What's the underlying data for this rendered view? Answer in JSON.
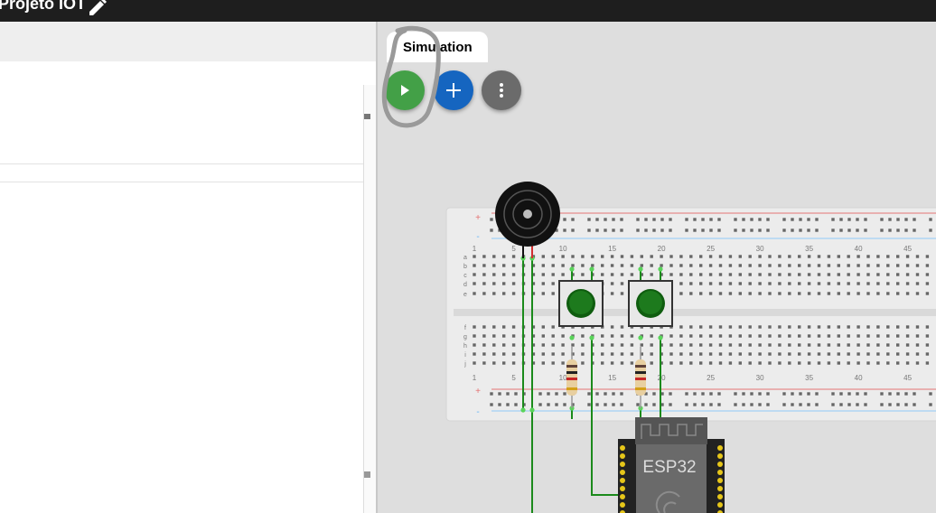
{
  "app": {
    "project_title": "Projeto IOT",
    "icons": {
      "edit": "pencil-icon"
    }
  },
  "simulation": {
    "tab_label": "Simulation",
    "controls": [
      {
        "name": "start-simulation-button",
        "icon": "play-icon",
        "color": "#43a047"
      },
      {
        "name": "add-part-button",
        "icon": "plus-icon",
        "color": "#1565c0"
      },
      {
        "name": "more-options-button",
        "icon": "more-vertical-icon",
        "color": "#6b6b6b"
      }
    ]
  },
  "diagram": {
    "microcontroller_label": "ESP32",
    "breadboard_column_numbers": [
      "1",
      "5",
      "10",
      "15",
      "20",
      "25",
      "30",
      "35",
      "40",
      "45"
    ],
    "breadboard_row_letters_top": [
      "a",
      "b",
      "c",
      "d",
      "e"
    ],
    "breadboard_row_letters_bottom": [
      "f",
      "g",
      "h",
      "i",
      "j"
    ],
    "rail_plus": "+",
    "rail_minus": "-",
    "colors": {
      "wire": "#1b8a1b",
      "button_cap": "#1d7a1d",
      "rail_red": "#e57373",
      "rail_blue": "#90caf9",
      "esp32": "#2b2b2b"
    }
  }
}
